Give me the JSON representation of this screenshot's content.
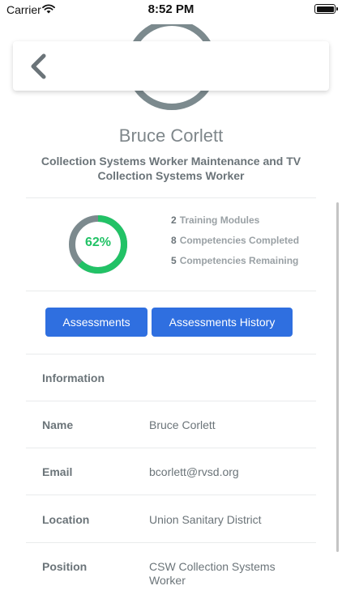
{
  "status_bar": {
    "carrier": "Carrier",
    "time": "8:52 PM"
  },
  "profile": {
    "name": "Bruce Corlett",
    "title": "Collection Systems Worker Maintenance and TV Collection Systems Worker"
  },
  "progress": {
    "percent_label": "62%",
    "value": 0.62
  },
  "stats": [
    {
      "number": "2",
      "label": "Training Modules"
    },
    {
      "number": "8",
      "label": "Competencies Completed"
    },
    {
      "number": "5",
      "label": "Competencies Remaining"
    }
  ],
  "buttons": {
    "assessments": "Assessments",
    "history": "Assessments History"
  },
  "information": {
    "heading": "Information",
    "rows": [
      {
        "key": "Name",
        "value": "Bruce Corlett"
      },
      {
        "key": "Email",
        "value": "bcorlett@rvsd.org"
      },
      {
        "key": "Location",
        "value": "Union Sanitary District"
      },
      {
        "key": "Position",
        "value": "CSW Collection Systems Worker"
      }
    ]
  },
  "colors": {
    "accent": "#2f6fe0",
    "progress": "#22c266",
    "track": "#7c8a8e"
  }
}
